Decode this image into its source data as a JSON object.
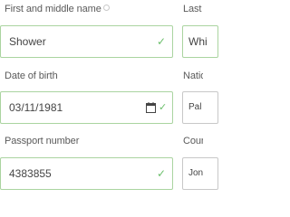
{
  "form": {
    "first_name": {
      "label": "First and middle name",
      "value": "Shower"
    },
    "last_name": {
      "label": "Last n",
      "value": "Whi"
    },
    "dob": {
      "label": "Date of birth",
      "value": "03/11/1981"
    },
    "nationality": {
      "label": "Nation",
      "value": "Pal"
    },
    "passport": {
      "label": "Passport number",
      "value": "4383855"
    },
    "country": {
      "label": "Count",
      "value": "Jon"
    }
  },
  "icons": {
    "valid": "checkmark-icon",
    "info": "info-icon",
    "calendar": "calendar-icon"
  },
  "colors": {
    "valid_border": "#aad4a0",
    "check": "#6cbf6c",
    "neutral_border": "#c8c8c8"
  }
}
